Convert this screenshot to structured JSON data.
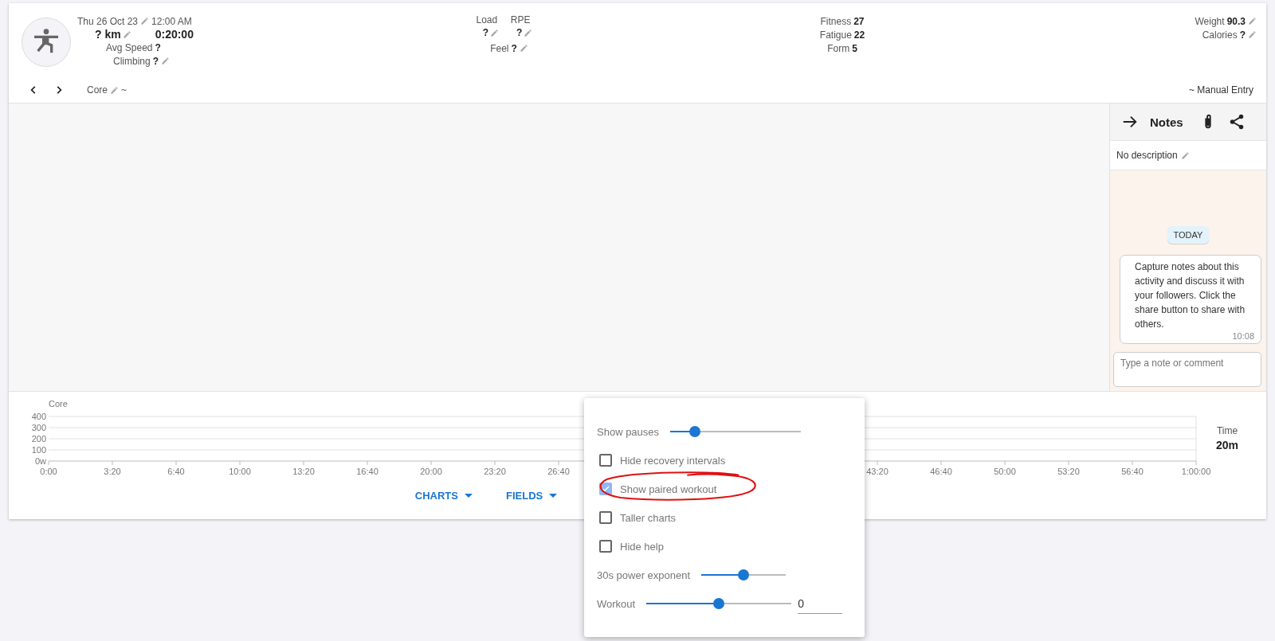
{
  "header": {
    "date": {
      "value": "Thu 26 Oct 23",
      "editable": true
    },
    "time": "12:00 AM",
    "distance": {
      "value": "? km",
      "editable": true
    },
    "duration": "0:20:00",
    "avg_speed": {
      "label": "Avg Speed",
      "value": "?"
    },
    "climbing": {
      "label": "Climbing",
      "value": "?",
      "editable": true
    },
    "activity_type": {
      "value": "Core",
      "editable": true
    },
    "type_suffix": "~",
    "load": {
      "label": "Load",
      "value": "?",
      "editable": true
    },
    "rpe": {
      "label": "RPE",
      "value": "?",
      "editable": true
    },
    "feel": {
      "label": "Feel",
      "value": "?",
      "editable": true
    },
    "fitness": [
      {
        "label": "Fitness",
        "value": "27"
      },
      {
        "label": "Fatigue",
        "value": "22"
      },
      {
        "label": "Form",
        "value": "5"
      }
    ],
    "body": [
      {
        "label": "Weight",
        "value": "90.3",
        "editable": true
      },
      {
        "label": "Calories",
        "value": "?",
        "editable": true
      }
    ],
    "source": "~ Manual Entry"
  },
  "notes": {
    "title": "Notes",
    "description": {
      "value": "No description",
      "editable": true
    },
    "day_label": "TODAY",
    "messages": [
      {
        "text": "Capture notes about this activity and discuss it with your followers. Click the share button to share with others.",
        "time": "10:08"
      }
    ],
    "input": {
      "placeholder": "Type a note or comment"
    }
  },
  "chart_section": {
    "chart_data": {
      "type": "line",
      "title": "Core",
      "grid": true,
      "xlim": [
        0,
        3600
      ],
      "ylim": [
        0,
        400
      ],
      "xticks": [
        {
          "value": 0,
          "label": "0:00"
        },
        {
          "value": 200,
          "label": "3:20"
        },
        {
          "value": 400,
          "label": "6:40"
        },
        {
          "value": 600,
          "label": "10:00"
        },
        {
          "value": 800,
          "label": "13:20"
        },
        {
          "value": 1000,
          "label": "16:40"
        },
        {
          "value": 1200,
          "label": "20:00"
        },
        {
          "value": 1400,
          "label": "23:20"
        },
        {
          "value": 1600,
          "label": "26:40"
        },
        {
          "value": 2600,
          "label": "43:20"
        },
        {
          "value": 2800,
          "label": "46:40"
        },
        {
          "value": 3000,
          "label": "50:00"
        },
        {
          "value": 3200,
          "label": "53:20"
        },
        {
          "value": 3400,
          "label": "56:40"
        },
        {
          "value": 3600,
          "label": "1:00:00"
        }
      ],
      "yticks": [
        {
          "value": 0,
          "label": "0w"
        },
        100,
        200,
        300,
        400
      ]
    },
    "side_stat": {
      "label": "Time",
      "value": "20m"
    },
    "buttons": [
      {
        "label": "CHARTS"
      },
      {
        "label": "FIELDS"
      }
    ]
  },
  "popup": {
    "items": [
      {
        "kind": "slider",
        "label": "Show pauses",
        "level": 0.16
      },
      {
        "kind": "checkbox",
        "label": "Hide recovery intervals",
        "checked": false
      },
      {
        "kind": "checkbox",
        "label": "Show paired workout",
        "checked": true
      },
      {
        "kind": "checkbox",
        "label": "Taller charts",
        "checked": false
      },
      {
        "kind": "checkbox",
        "label": "Hide help",
        "checked": false
      },
      {
        "kind": "slider",
        "label": "30s power exponent",
        "level": 0.5
      },
      {
        "kind": "slider",
        "label": "Workout",
        "level": 0.5,
        "value": "0"
      }
    ]
  },
  "annotations": [
    {
      "kind": "ellipse",
      "color": "#e01010"
    }
  ]
}
